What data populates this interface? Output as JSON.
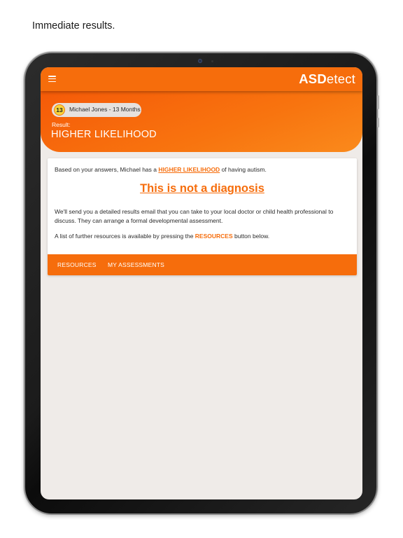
{
  "caption": "Immediate results.",
  "app": {
    "logo_bold": "ASD",
    "logo_regular": "etect"
  },
  "child": {
    "age_badge": "13",
    "name_label": "Michael Jones - 13 Months"
  },
  "result": {
    "label": "Result:",
    "value": "HIGHER LIKELIHOOD"
  },
  "card": {
    "p1_prefix": "Based on your answers, Michael has a ",
    "p1_highlight": "HIGHER LIKELIHOOD",
    "p1_suffix": " of having autism.",
    "headline": "This is not a diagnosis",
    "p2": "We'll send you a detailed results email that you can take to your local doctor or child health professional to discuss. They can arrange a formal developmental assessment.",
    "p3_prefix": "A list of further resources is available by pressing the ",
    "p3_highlight": "RESOURCES",
    "p3_suffix": " button below.",
    "actions": {
      "resources": "RESOURCES",
      "my_assessments": "MY ASSESSMENTS"
    }
  },
  "icons": {
    "menu": "hamburger-menu-icon"
  },
  "colors": {
    "brand_orange": "#f66d0c",
    "screen_background": "#efebe8",
    "badge_yellow": "#f8d53a"
  }
}
